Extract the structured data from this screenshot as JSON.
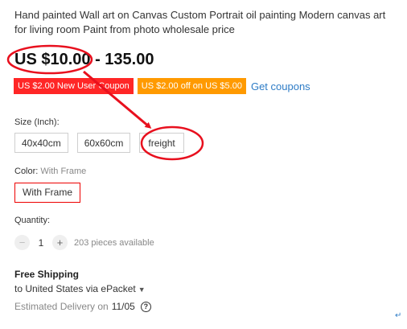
{
  "product": {
    "title": "Hand painted Wall art on Canvas Custom Portrait oil painting Modern canvas art for living room Paint from photo wholesale price",
    "price": "US $10.00 - 135.00"
  },
  "coupons": {
    "new_user": "US $2.00 New User Coupon",
    "off": "US $2.00 off on US $5.00",
    "get_link": "Get coupons"
  },
  "size": {
    "label": "Size (Inch):",
    "options": [
      "40x40cm",
      "60x60cm",
      "freight"
    ]
  },
  "color": {
    "label": "Color:",
    "selected": "With Frame",
    "option": "With Frame"
  },
  "quantity": {
    "label": "Quantity:",
    "minus": "−",
    "value": "1",
    "plus": "+",
    "available": "203 pieces available"
  },
  "shipping": {
    "title": "Free Shipping",
    "destination": "to United States via ePacket",
    "delivery_label": "Estimated Delivery on",
    "delivery_date": "11/05"
  },
  "icons": {
    "help": "question-circle-icon",
    "caret": "chevron-down-icon",
    "return": "return-arrow-icon"
  },
  "annotation_color": "#e8101e"
}
